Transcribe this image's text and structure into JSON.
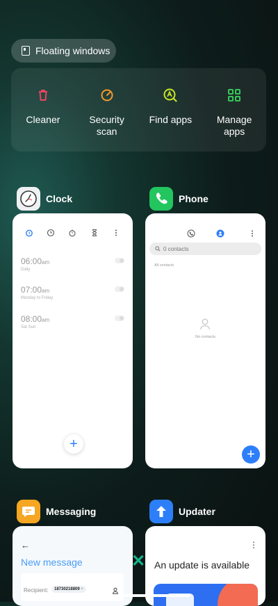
{
  "floating": {
    "label": "Floating windows"
  },
  "tools": [
    {
      "label": "Cleaner",
      "icon": "trash-icon",
      "color": "#e9465d"
    },
    {
      "label": "Security\nscan",
      "icon": "security-scan-icon",
      "color": "#f39a2b"
    },
    {
      "label": "Find apps",
      "icon": "find-apps-icon",
      "color": "#c8e628"
    },
    {
      "label": "Manage\napps",
      "icon": "manage-apps-icon",
      "color": "#36c65a"
    }
  ],
  "apps": {
    "clock": {
      "name": "Clock",
      "alarms": [
        {
          "time": "06:00",
          "ampm": "am",
          "label": "Daily"
        },
        {
          "time": "07:00",
          "ampm": "am",
          "label": "Monday to Friday"
        },
        {
          "time": "08:00",
          "ampm": "am",
          "label": "Sat Sun"
        }
      ],
      "fab": "+"
    },
    "phone": {
      "name": "Phone",
      "search_placeholder": "0 contacts",
      "section": "All contacts",
      "empty": "No contacts",
      "fab": "+"
    },
    "messaging": {
      "name": "Messaging",
      "back": "←",
      "title": "New message",
      "recipient_label": "Recipient:",
      "recipient_chip": "18730218809",
      "chip_close": "×"
    },
    "updater": {
      "name": "Updater",
      "headline": "An update is available",
      "menu": "⋮"
    }
  },
  "close_all": "✕"
}
